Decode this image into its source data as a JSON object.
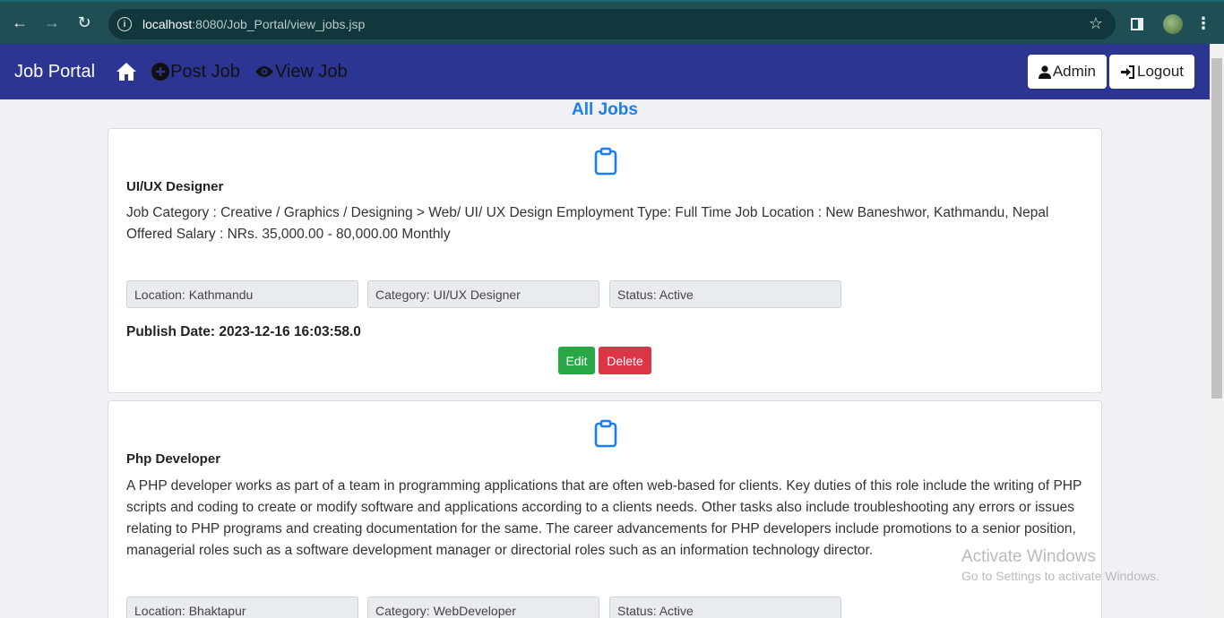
{
  "browser": {
    "url_host": "localhost",
    "url_path": ":8080/Job_Portal/view_jobs.jsp"
  },
  "navbar": {
    "brand": "Job Portal",
    "links": [
      {
        "label": "Post Job",
        "icon": "plus-circle-icon"
      },
      {
        "label": "View Job",
        "icon": "eye-icon"
      }
    ],
    "admin_label": "Admin",
    "logout_label": "Logout",
    "bg_color": "#2c3592"
  },
  "page": {
    "title": "All Jobs",
    "accent_color": "#1b7ef0"
  },
  "jobs": [
    {
      "title": "UI/UX Designer",
      "description": "Job Category : Creative / Graphics / Designing > Web/ UI/ UX Design Employment Type: Full Time Job Location : New Baneshwor, Kathmandu, Nepal Offered Salary : NRs. 35,000.00 - 80,000.00 Monthly",
      "location": "Location: Kathmandu",
      "category": "Category: UI/UX Designer",
      "status": "Status: Active",
      "publish": "Publish Date: 2023-12-16 16:03:58.0",
      "edit_label": "Edit",
      "delete_label": "Delete"
    },
    {
      "title": "Php Developer",
      "description": "A PHP developer works as part of a team in programming applications that are often web-based for clients. Key duties of this role include the writing of PHP scripts and coding to create or modify software and applications according to a clients needs. Other tasks also include troubleshooting any errors or issues relating to PHP programs and creating documentation for the same. The career advancements for PHP developers include promotions to a senior position, managerial roles such as a software development manager or directorial roles such as an information technology director.",
      "location": "Location: Bhaktapur",
      "category": "Category: WebDeveloper",
      "status": "Status: Active"
    }
  ],
  "watermark": {
    "line1": "Activate Windows",
    "line2": "Go to Settings to activate Windows."
  }
}
